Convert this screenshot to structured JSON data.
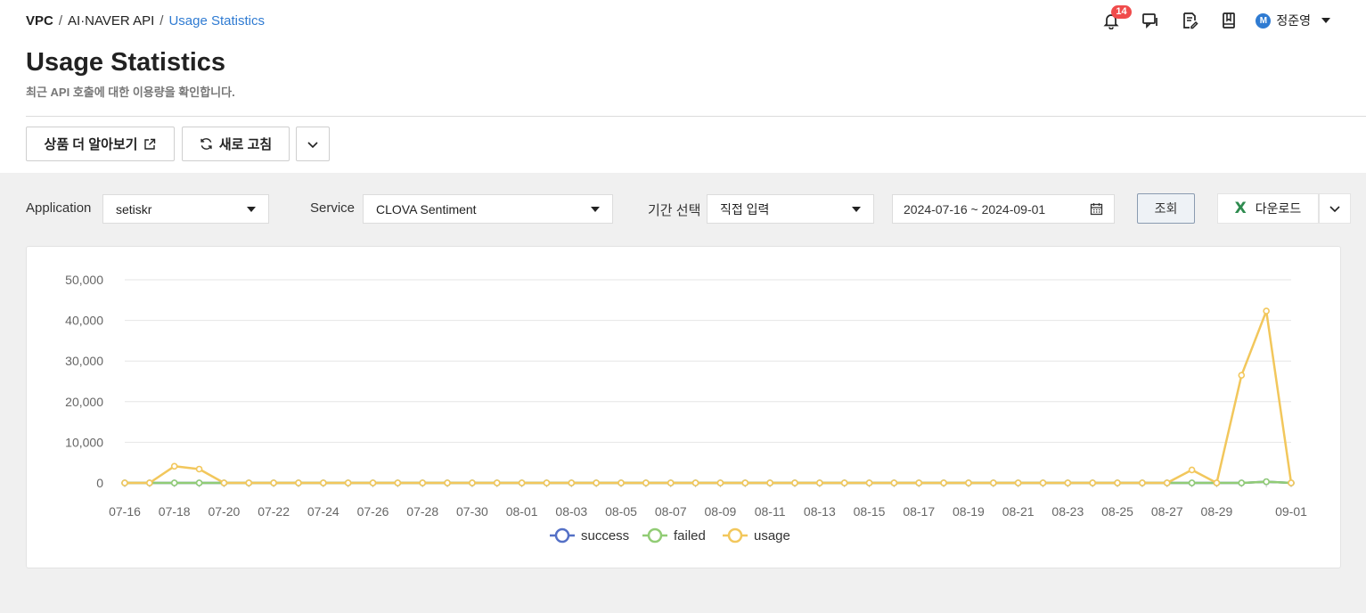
{
  "breadcrumb": {
    "root": "VPC",
    "sep1": "/",
    "section": "AI·NAVER API",
    "sep2": "/",
    "current": "Usage Statistics"
  },
  "header": {
    "notification_count": "14",
    "avatar_initial": "M",
    "user_name": "정준영"
  },
  "page": {
    "title": "Usage Statistics",
    "subtitle": "최근 API 호출에 대한 이용량을 확인합니다."
  },
  "actions": {
    "learn_more_label": "상품 더 알아보기",
    "refresh_label": "새로 고침"
  },
  "filters": {
    "application_label": "Application",
    "application_value": "setiskr",
    "service_label": "Service",
    "service_value": "CLOVA Sentiment",
    "period_label": "기간 선택",
    "period_value": "직접 입력",
    "date_range": "2024-07-16 ~ 2024-09-01",
    "query_label": "조회",
    "download_label": "다운로드",
    "download_icon_text": "X"
  },
  "colors": {
    "accent": "#2f7bd2",
    "success": "#5470c6",
    "failed": "#91cc75",
    "usage": "#f2c75c",
    "badge": "#f04b4b"
  },
  "chart_data": {
    "type": "line",
    "x": [
      "07-16",
      "07-17",
      "07-18",
      "07-19",
      "07-20",
      "07-21",
      "07-22",
      "07-23",
      "07-24",
      "07-25",
      "07-26",
      "07-27",
      "07-28",
      "07-29",
      "07-30",
      "07-31",
      "08-01",
      "08-02",
      "08-03",
      "08-04",
      "08-05",
      "08-06",
      "08-07",
      "08-08",
      "08-09",
      "08-10",
      "08-11",
      "08-12",
      "08-13",
      "08-14",
      "08-15",
      "08-16",
      "08-17",
      "08-18",
      "08-19",
      "08-20",
      "08-21",
      "08-22",
      "08-23",
      "08-24",
      "08-25",
      "08-26",
      "08-27",
      "08-28",
      "08-29",
      "08-30",
      "08-31",
      "09-01"
    ],
    "x_tick_labels": [
      "07-16",
      "07-18",
      "07-20",
      "07-22",
      "07-24",
      "07-26",
      "07-28",
      "07-30",
      "08-01",
      "08-03",
      "08-05",
      "08-07",
      "08-09",
      "08-11",
      "08-13",
      "08-15",
      "08-17",
      "08-19",
      "08-21",
      "08-23",
      "08-25",
      "08-27",
      "08-29",
      "09-01"
    ],
    "y_ticks": [
      "0",
      "10,000",
      "20,000",
      "30,000",
      "40,000",
      "50,000"
    ],
    "ylim": [
      0,
      50000
    ],
    "grid": true,
    "legend_position": "bottom-center",
    "series": [
      {
        "name": "success",
        "values": [
          0,
          0,
          0,
          0,
          0,
          0,
          0,
          0,
          0,
          0,
          0,
          0,
          0,
          0,
          0,
          0,
          0,
          0,
          0,
          0,
          0,
          0,
          0,
          0,
          0,
          0,
          0,
          0,
          0,
          0,
          0,
          0,
          0,
          0,
          0,
          0,
          0,
          0,
          0,
          0,
          0,
          0,
          0,
          0,
          0,
          0,
          300,
          0
        ]
      },
      {
        "name": "failed",
        "values": [
          0,
          0,
          0,
          0,
          0,
          0,
          0,
          0,
          0,
          0,
          0,
          0,
          0,
          0,
          0,
          0,
          0,
          0,
          0,
          0,
          0,
          0,
          0,
          0,
          0,
          0,
          0,
          0,
          0,
          0,
          0,
          0,
          0,
          0,
          0,
          0,
          0,
          0,
          0,
          0,
          0,
          0,
          0,
          0,
          0,
          0,
          300,
          0
        ]
      },
      {
        "name": "usage",
        "values": [
          0,
          0,
          4100,
          3400,
          0,
          0,
          0,
          0,
          0,
          0,
          0,
          0,
          0,
          0,
          0,
          0,
          0,
          0,
          0,
          0,
          0,
          0,
          0,
          0,
          0,
          0,
          0,
          0,
          0,
          0,
          0,
          0,
          0,
          0,
          0,
          0,
          0,
          0,
          0,
          0,
          0,
          0,
          0,
          3200,
          0,
          26500,
          42300,
          0
        ]
      }
    ]
  }
}
